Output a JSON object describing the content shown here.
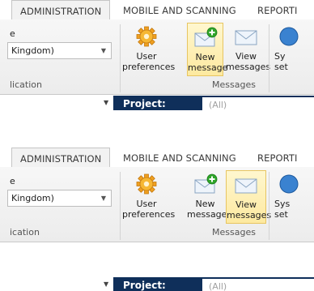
{
  "panels": [
    {
      "tabs": [
        "ADMINISTRATION",
        "MOBILE AND SCANNING",
        "REPORTI"
      ],
      "field_label": "e",
      "combo_value": "Kingdom)",
      "group_left_caption": "lication",
      "user_prefs": {
        "line1": "User",
        "line2": "preferences"
      },
      "new_message": {
        "line1": "New",
        "line2": "message"
      },
      "view_messages": {
        "line1": "View",
        "line2": "messages"
      },
      "sys_settings": {
        "line1": "Sy",
        "line2": "set"
      },
      "group_messages_caption": "Messages",
      "project_label": "Project:",
      "project_value": "(All)"
    },
    {
      "tabs": [
        "ADMINISTRATION",
        "MOBILE AND SCANNING",
        "REPORTI"
      ],
      "field_label": "e",
      "combo_value": "Kingdom)",
      "group_left_caption": "ication",
      "user_prefs": {
        "line1": "User",
        "line2": "preferences"
      },
      "new_message": {
        "line1": "New",
        "line2": "message"
      },
      "view_messages": {
        "line1": "View",
        "line2": "messages"
      },
      "sys_settings": {
        "line1": "Sys",
        "line2": "set"
      },
      "group_messages_caption": "Messages",
      "project_label": "Project:",
      "project_value": "(All)"
    }
  ],
  "highlighted_button": [
    "new-message",
    "view-messages"
  ],
  "colors": {
    "accent_bar": "#0f2f5a",
    "highlight": "#fde9a0"
  }
}
